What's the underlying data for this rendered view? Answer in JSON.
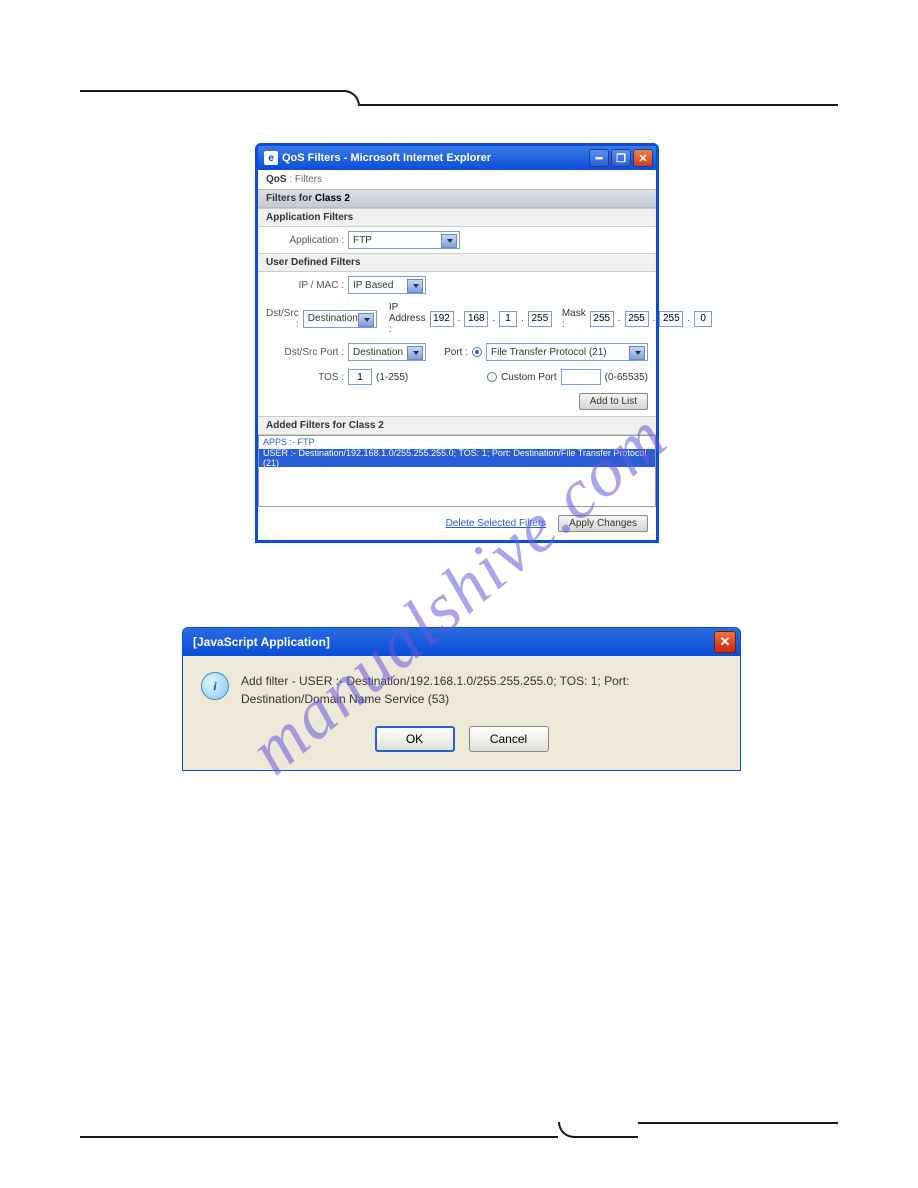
{
  "watermark": "manualshive.com",
  "win1": {
    "title": "QoS Filters - Microsoft Internet Explorer",
    "breadcrumb_prefix": "QoS",
    "breadcrumb_sep": " : ",
    "breadcrumb_item": "Filters",
    "section_prefix": "Filters for ",
    "section_class": "Class 2",
    "app_filters_heading": "Application Filters",
    "application_label": "Application :",
    "application_value": "FTP",
    "user_filters_heading": "User Defined Filters",
    "ipmac_label": "IP / MAC :",
    "ipmac_value": "IP Based",
    "dstsrc_label": "Dst/Src :",
    "dstsrc_value": "Destination",
    "ipaddress_label": "IP Address :",
    "ip": [
      "192",
      "168",
      "1",
      "255"
    ],
    "mask_label": "Mask :",
    "mask": [
      "255",
      "255",
      "255",
      "0"
    ],
    "dstsrcport_label": "Dst/Src Port :",
    "dstsrcport_value": "Destination",
    "port_label": "Port :",
    "port_select_value": "File Transfer Protocol (21)",
    "customport_label": "Custom Port",
    "customport_hint": "(0-65535)",
    "tos_label": "TOS :",
    "tos_value": "1",
    "tos_hint": "(1-255)",
    "add_to_list": "Add to List",
    "added_heading_prefix": "Added Filters for ",
    "added_heading_class": "Class 2",
    "filters": [
      "APPS :- FTP",
      "USER :- Destination/192.168.1.0/255.255.255.0; TOS: 1; Port: Destination/File Transfer Protocol (21)"
    ],
    "delete_link": "Delete Selected Filters",
    "apply_btn": "Apply Changes"
  },
  "win2": {
    "title": "[JavaScript Application]",
    "message": "Add filter - USER :- Destination/192.168.1.0/255.255.255.0; TOS: 1; Port: Destination/Domain Name Service (53)",
    "ok": "OK",
    "cancel": "Cancel"
  }
}
